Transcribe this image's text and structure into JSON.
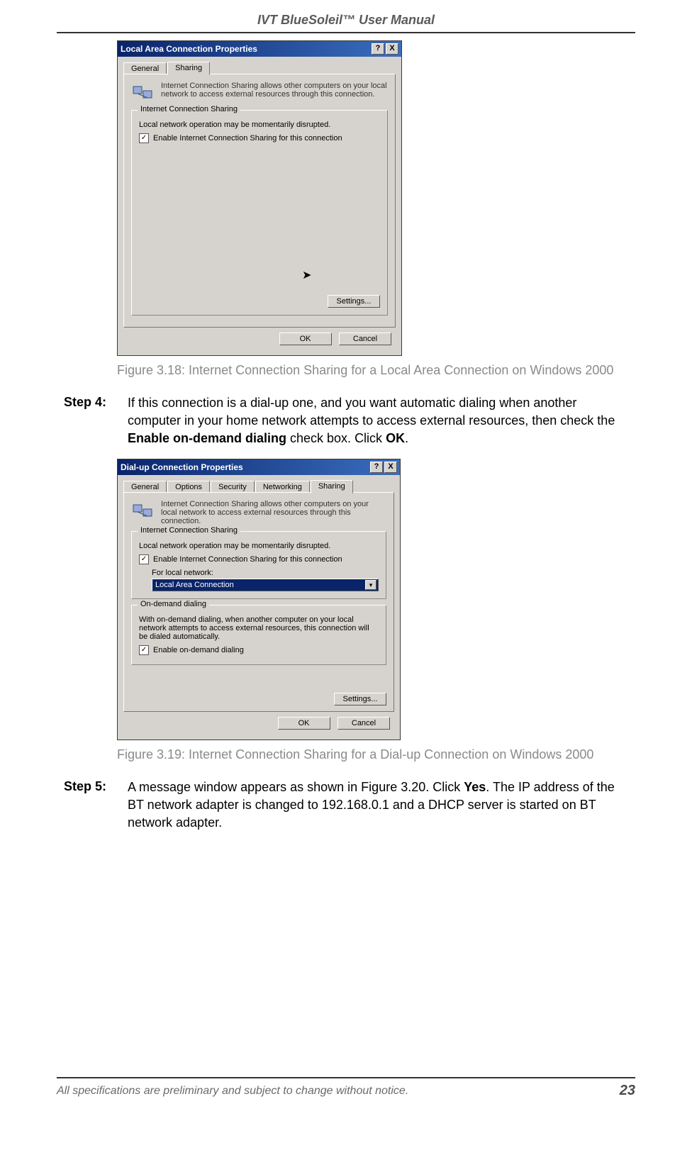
{
  "header": {
    "title": "IVT BlueSoleil™ User Manual"
  },
  "dialog1": {
    "title": "Local Area Connection Properties",
    "help_btn": "?",
    "close_btn": "X",
    "tabs": {
      "general": "General",
      "sharing": "Sharing"
    },
    "info": "Internet Connection Sharing allows other computers on your local network to access external resources through this connection.",
    "group_legend": "Internet Connection Sharing",
    "note": "Local network operation may be momentarily disrupted.",
    "chk_label": "Enable Internet Connection Sharing for this connection",
    "settings_btn": "Settings...",
    "ok_btn": "OK",
    "cancel_btn": "Cancel"
  },
  "fig1_caption": "Figure 3.18: Internet Connection Sharing for a Local Area Connection on Windows 2000",
  "step4": {
    "label": "Step 4:",
    "pre": "If this connection is a dial-up one, and you want automatic dialing when another computer in your home network attempts to access external resources, then check the ",
    "bold1": "Enable on-demand dialing",
    "mid": " check box. Click ",
    "bold2": "OK",
    "post": "."
  },
  "dialog2": {
    "title": "Dial-up Connection Properties",
    "help_btn": "?",
    "close_btn": "X",
    "tabs": {
      "general": "General",
      "options": "Options",
      "security": "Security",
      "networking": "Networking",
      "sharing": "Sharing"
    },
    "info": "Internet Connection Sharing allows other computers on your local network to access external resources through this connection.",
    "group1_legend": "Internet Connection Sharing",
    "note1": "Local network operation may be momentarily disrupted.",
    "chk1_label": "Enable Internet Connection Sharing for this connection",
    "for_label": "For local network:",
    "dropdown_value": "Local Area Connection",
    "group2_legend": "On-demand dialing",
    "note2": "With on-demand dialing, when another computer on your local network attempts to access external resources, this connection will be dialed automatically.",
    "chk2_label": "Enable on-demand dialing",
    "settings_btn": "Settings...",
    "ok_btn": "OK",
    "cancel_btn": "Cancel"
  },
  "fig2_caption": "Figure 3.19: Internet Connection Sharing for a Dial-up Connection on Windows 2000",
  "step5": {
    "label": "Step 5:",
    "pre": "A message window appears as shown in Figure 3.20. Click ",
    "bold1": "Yes",
    "post": ". The IP address of the BT network adapter is changed to 192.168.0.1 and a DHCP server is started on BT network adapter."
  },
  "footer": {
    "text": "All specifications are preliminary and subject to change without notice.",
    "page": "23"
  }
}
